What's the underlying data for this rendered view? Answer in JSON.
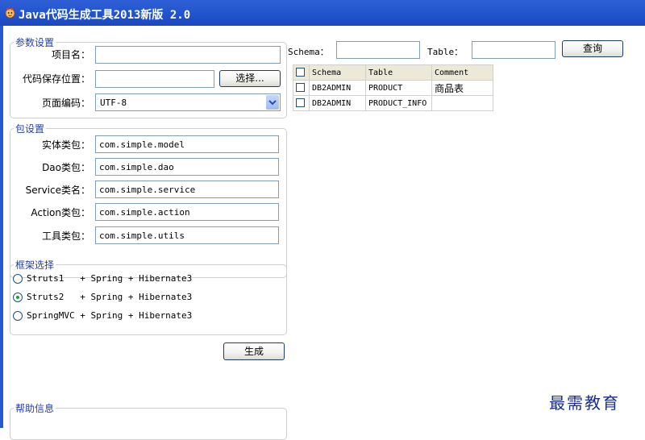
{
  "window": {
    "title": "Java代码生成工具2013新版 2.0"
  },
  "params": {
    "legend": "参数设置",
    "project_label": "项目名：",
    "project_value": "",
    "save_label": "代码保存位置：",
    "save_value": "",
    "browse_button": "选择...",
    "encoding_label": "页面编码：",
    "encoding_value": "UTF-8"
  },
  "packages": {
    "legend": "包设置",
    "entity_label": "实体类包：",
    "entity_value": "com.simple.model",
    "dao_label": "Dao类包：",
    "dao_value": "com.simple.dao",
    "service_label": "Service类名：",
    "service_value": "com.simple.service",
    "action_label": "Action类包：",
    "action_value": "com.simple.action",
    "utils_label": "工具类包：",
    "utils_value": "com.simple.utils"
  },
  "framework": {
    "legend": "框架选择",
    "options": [
      {
        "label": "Struts1   + Spring + Hibernate3",
        "checked": false
      },
      {
        "label": "Struts2   + Spring + Hibernate3",
        "checked": true
      },
      {
        "label": "SpringMVC + Spring + Hibernate3",
        "checked": false
      }
    ]
  },
  "generate_button": "生成",
  "help": {
    "legend": "帮助信息"
  },
  "search": {
    "schema_label": "Schema：",
    "schema_value": "",
    "table_label": "Table：",
    "table_value": "",
    "query_button": "查询"
  },
  "grid": {
    "headers": [
      "Schema",
      "Table",
      "Comment"
    ],
    "rows": [
      {
        "schema": "DB2ADMIN",
        "table": "PRODUCT",
        "comment": "商品表"
      },
      {
        "schema": "DB2ADMIN",
        "table": "PRODUCT_INFO",
        "comment": ""
      }
    ]
  },
  "watermark": "最需教育",
  "colors": {
    "titlebar": "#2457d0",
    "legend": "#1f3fae",
    "radio_dot": "#21a121"
  }
}
